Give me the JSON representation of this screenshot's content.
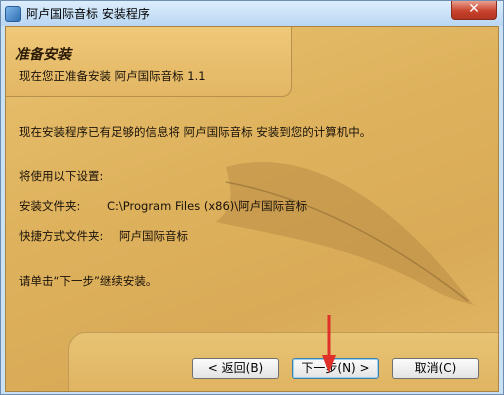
{
  "window": {
    "title": "阿卢国际音标 安装程序",
    "close_glyph": "✕"
  },
  "header": {
    "title": "准备安装",
    "subtitle": "现在您正准备安装 阿卢国际音标 1.1"
  },
  "body": {
    "intro": "现在安装程序已有足够的信息将 阿卢国际音标 安装到您的计算机中。",
    "settings_heading": "将使用以下设置:",
    "install_folder_label": "安装文件夹:",
    "install_folder_value": "C:\\Program Files (x86)\\阿卢国际音标",
    "shortcut_folder_label": "快捷方式文件夹:",
    "shortcut_folder_value": "阿卢国际音标",
    "continue_hint": "请单击“下一步”继续安装。"
  },
  "buttons": {
    "back": "< 返回(B)",
    "next": "下一步(N) >",
    "cancel": "取消(C)"
  },
  "colors": {
    "arrow": "#e0302a",
    "accent": "#3c7fb1"
  }
}
